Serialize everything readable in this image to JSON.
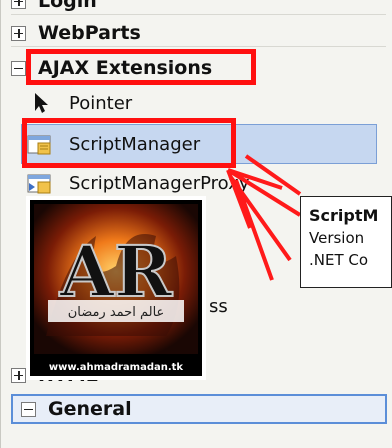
{
  "toolbox": {
    "categories": [
      {
        "label": "Login",
        "state": "collapsed"
      },
      {
        "label": "WebParts",
        "state": "collapsed"
      },
      {
        "label": "AJAX Extensions",
        "state": "expanded"
      }
    ],
    "ajax_items": [
      {
        "label": "Pointer",
        "icon": "pointer-arrow-icon"
      },
      {
        "label": "ScriptManager",
        "icon": "script-manager-icon",
        "selected": true
      },
      {
        "label": "ScriptManagerProxy",
        "icon": "script-manager-proxy-icon"
      }
    ],
    "partial_item_suffix": "ss",
    "html_category": "HTML",
    "general_category": "General"
  },
  "tooltip": {
    "title": "ScriptM",
    "line1": "Version",
    "line2": ".NET Co"
  },
  "watermark": {
    "logo_text": "AR",
    "arabic_text": "عالم احمد رمضان",
    "url": "www.ahmadramadan.tk"
  },
  "colors": {
    "highlight": "#ff1010",
    "selection": "#c6d7f0",
    "selection_border": "#7b9fd6"
  }
}
